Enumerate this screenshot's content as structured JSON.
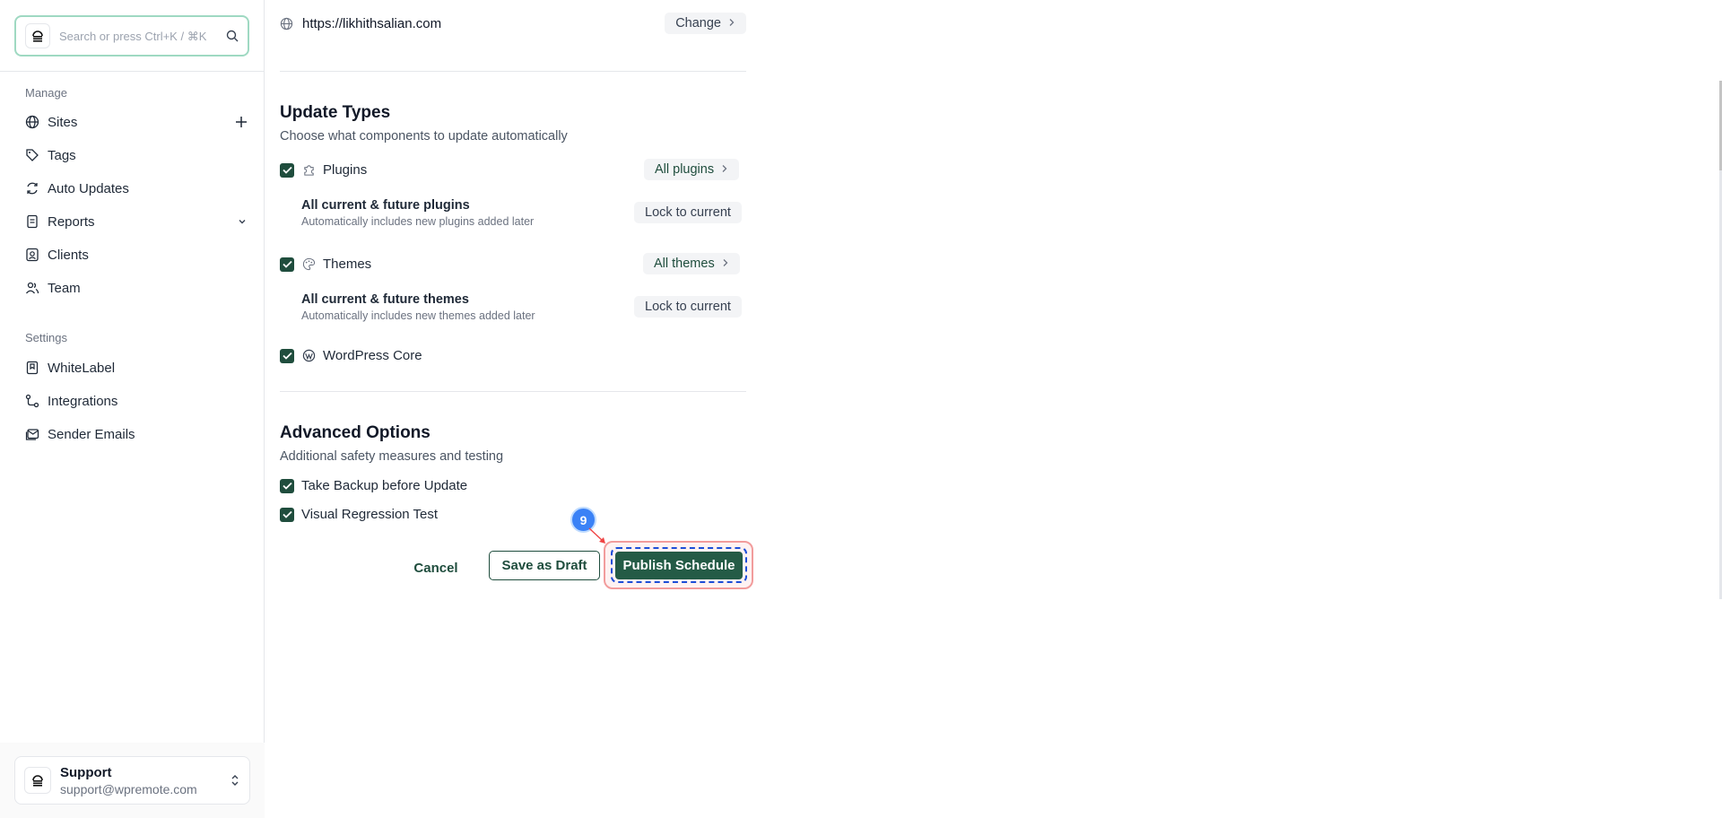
{
  "search": {
    "placeholder": "Search or press Ctrl+K / ⌘K"
  },
  "sidebar": {
    "manage_label": "Manage",
    "manage_items": [
      {
        "label": "Sites",
        "icon": "globe-icon"
      },
      {
        "label": "Tags",
        "icon": "tags-icon"
      },
      {
        "label": "Auto Updates",
        "icon": "refresh-icon"
      },
      {
        "label": "Reports",
        "icon": "report-icon"
      },
      {
        "label": "Clients",
        "icon": "client-icon"
      },
      {
        "label": "Team",
        "icon": "users-icon"
      }
    ],
    "settings_label": "Settings",
    "settings_items": [
      {
        "label": "WhiteLabel",
        "icon": "bookmark-icon"
      },
      {
        "label": "Integrations",
        "icon": "route-icon"
      },
      {
        "label": "Sender Emails",
        "icon": "mail-icon"
      }
    ],
    "support": {
      "name": "Support",
      "email": "support@wpremote.com"
    }
  },
  "main": {
    "site_url": "https://likhithsalian.com",
    "change_label": "Change",
    "update_types": {
      "title": "Update Types",
      "subtitle": "Choose what components to update automatically",
      "plugins": {
        "label": "Plugins",
        "pill": "All plugins",
        "sub_title": "All current & future plugins",
        "sub_desc": "Automatically includes new plugins added later",
        "lock_label": "Lock to current"
      },
      "themes": {
        "label": "Themes",
        "pill": "All themes",
        "sub_title": "All current & future themes",
        "sub_desc": "Automatically includes new themes added later",
        "lock_label": "Lock to current"
      },
      "core": {
        "label": "WordPress Core"
      }
    },
    "advanced": {
      "title": "Advanced Options",
      "subtitle": "Additional safety measures and testing",
      "backup_label": "Take Backup before Update",
      "regression_label": "Visual Regression Test"
    },
    "actions": {
      "cancel": "Cancel",
      "save_draft": "Save as Draft",
      "publish": "Publish Schedule"
    },
    "step_badge": "9"
  },
  "colors": {
    "brand_green": "#245b46",
    "search_focus": "#9fd9c2",
    "highlight_red": "#f29c9c",
    "step_blue": "#3b82f6"
  }
}
